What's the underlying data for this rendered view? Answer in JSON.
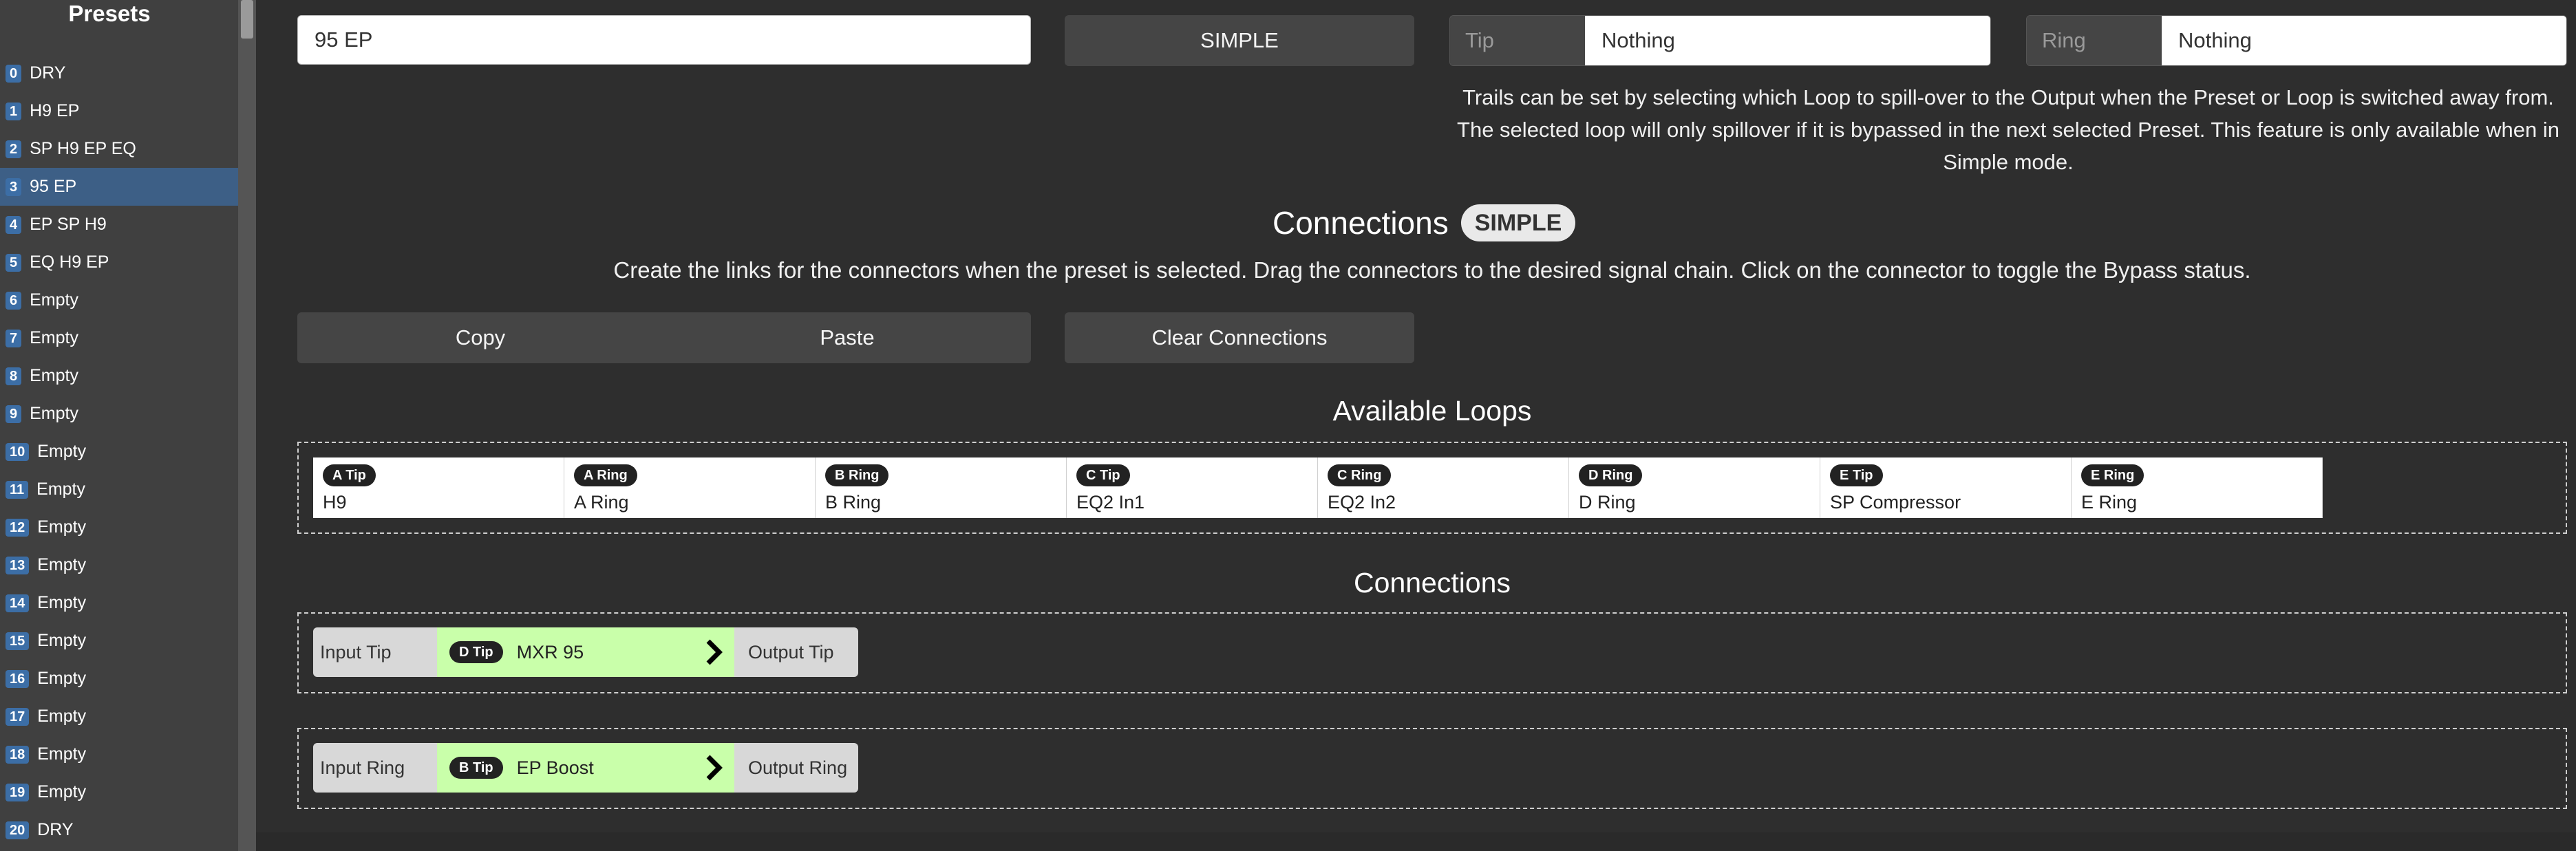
{
  "sidebar": {
    "title": "Presets",
    "items": [
      {
        "num": "0",
        "label": "DRY"
      },
      {
        "num": "1",
        "label": "H9 EP"
      },
      {
        "num": "2",
        "label": "SP H9 EP EQ"
      },
      {
        "num": "3",
        "label": "95 EP",
        "selected": true
      },
      {
        "num": "4",
        "label": "EP SP H9"
      },
      {
        "num": "5",
        "label": "EQ H9 EP"
      },
      {
        "num": "6",
        "label": "Empty"
      },
      {
        "num": "7",
        "label": "Empty"
      },
      {
        "num": "8",
        "label": "Empty"
      },
      {
        "num": "9",
        "label": "Empty"
      },
      {
        "num": "10",
        "label": "Empty"
      },
      {
        "num": "11",
        "label": "Empty"
      },
      {
        "num": "12",
        "label": "Empty"
      },
      {
        "num": "13",
        "label": "Empty"
      },
      {
        "num": "14",
        "label": "Empty"
      },
      {
        "num": "15",
        "label": "Empty"
      },
      {
        "num": "16",
        "label": "Empty"
      },
      {
        "num": "17",
        "label": "Empty"
      },
      {
        "num": "18",
        "label": "Empty"
      },
      {
        "num": "19",
        "label": "Empty"
      },
      {
        "num": "20",
        "label": "DRY"
      }
    ]
  },
  "preset": {
    "name_value": "95 EP",
    "mode_label": "SIMPLE"
  },
  "trails": {
    "tip_label": "Tip",
    "tip_value": "Nothing",
    "ring_label": "Ring",
    "ring_value": "Nothing",
    "description": "Trails can be set by selecting which Loop to spill-over to the Output when the Preset or Loop is switched away from. The selected loop will only spillover if it is bypassed in the next selected Preset. This feature is only available when in Simple mode."
  },
  "connections": {
    "title": "Connections",
    "mode_badge": "SIMPLE",
    "description": "Create the links for the connectors when the preset is selected. Drag the connectors to the desired signal chain. Click on the connector to toggle the Bypass status.",
    "copy_label": "Copy",
    "paste_label": "Paste",
    "clear_label": "Clear Connections",
    "available_title": "Available Loops",
    "chains_title": "Connections"
  },
  "loops": [
    {
      "badge": "A Tip",
      "name": "H9"
    },
    {
      "badge": "A Ring",
      "name": "A Ring"
    },
    {
      "badge": "B Ring",
      "name": "B Ring"
    },
    {
      "badge": "C Tip",
      "name": "EQ2 In1"
    },
    {
      "badge": "C Ring",
      "name": "EQ2 In2"
    },
    {
      "badge": "D Ring",
      "name": "D Ring"
    },
    {
      "badge": "E Tip",
      "name": "SP Compressor"
    },
    {
      "badge": "E Ring",
      "name": "E Ring"
    }
  ],
  "chains": [
    {
      "input": "Input Tip",
      "badge": "D Tip",
      "node": "MXR 95",
      "output": "Output Tip"
    },
    {
      "input": "Input Ring",
      "badge": "B Tip",
      "node": "EP Boost",
      "output": "Output Ring"
    }
  ],
  "colors": {
    "selected_preset": "#3d5f86",
    "preset_number": "#3c6ea6",
    "active_node": "#c9ffaa"
  }
}
